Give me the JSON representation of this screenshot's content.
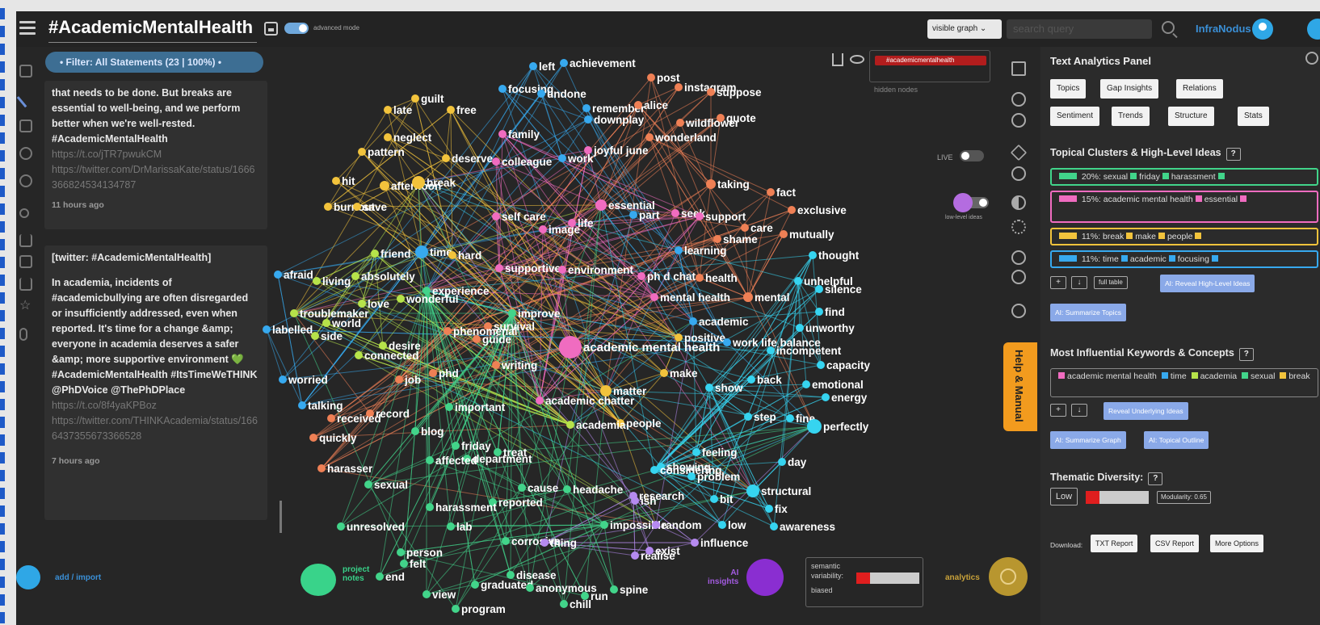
{
  "app": {
    "title": "#AcademicMentalHealth",
    "advanced_mode_label": "advanced mode",
    "brand": "InfraNodus",
    "graph_select": "visible graph",
    "search_placeholder": "search query"
  },
  "filter": {
    "label": "• Filter: All Statements (23 | 100%) •"
  },
  "posts": [
    {
      "body": "that needs to be done. But breaks are essential to well-being, and we perform better when we're well-rested. #AcademicMentalHealth",
      "links": [
        "https://t.co/jTR7pwukCM",
        "https://twitter.com/DrMarissaKate/status/1666366824534134787"
      ],
      "time": "11 hours ago"
    },
    {
      "source": "[twitter: #AcademicMentalHealth]",
      "body": "In academia, incidents of #academicbullying are often disregarded or insufficiently addressed, even when reported. It's time for a change &amp; everyone in academia deserves a safer &amp; more supportive environment 💚 #AcademicMentalHealth #ItsTimeWeTHINK @PhDVoice @ThePhDPlace",
      "links": [
        "https://t.co/8f4yaKPBoz",
        "https://twitter.com/THINKAcademia/status/1666437355673366528"
      ],
      "time": "7 hours ago"
    }
  ],
  "graph": {
    "hidden_tag": "#academicmentalhealth",
    "hidden_label": "hidden nodes",
    "live_label": "LIVE",
    "lowlevel_label": "low-level ideas",
    "colors": {
      "pink": "#f06cc0",
      "orange": "#ef8055",
      "yellow": "#f2c33c",
      "lime": "#b6e34a",
      "green": "#42d48a",
      "blue": "#37a9ef",
      "cyan": "#36d4f0",
      "violet": "#b68af0"
    },
    "nodes": [
      {
        "t": "left",
        "c": "blue"
      },
      {
        "t": "achievement",
        "c": "blue"
      },
      {
        "t": "post",
        "c": "orange"
      },
      {
        "t": "focusing",
        "c": "blue"
      },
      {
        "t": "undone",
        "c": "blue"
      },
      {
        "t": "instagram",
        "c": "orange"
      },
      {
        "t": "suppose",
        "c": "orange"
      },
      {
        "t": "remember",
        "c": "blue"
      },
      {
        "t": "alice",
        "c": "orange"
      },
      {
        "t": "downplay",
        "c": "blue"
      },
      {
        "t": "wildflower",
        "c": "orange"
      },
      {
        "t": "quote",
        "c": "orange"
      },
      {
        "t": "guilt",
        "c": "yellow"
      },
      {
        "t": "late",
        "c": "yellow"
      },
      {
        "t": "free",
        "c": "yellow"
      },
      {
        "t": "family",
        "c": "pink"
      },
      {
        "t": "wonderland",
        "c": "orange"
      },
      {
        "t": "neglect",
        "c": "yellow"
      },
      {
        "t": "joyful june",
        "c": "pink"
      },
      {
        "t": "pattern",
        "c": "yellow"
      },
      {
        "t": "deserve",
        "c": "yellow"
      },
      {
        "t": "colleague",
        "c": "pink"
      },
      {
        "t": "work",
        "c": "blue"
      },
      {
        "t": "hit",
        "c": "yellow"
      },
      {
        "t": "afternoon",
        "c": "yellow"
      },
      {
        "t": "break",
        "c": "yellow"
      },
      {
        "t": "taking",
        "c": "orange"
      },
      {
        "t": "fact",
        "c": "orange"
      },
      {
        "t": "burnout",
        "c": "yellow"
      },
      {
        "t": "save",
        "c": "yellow"
      },
      {
        "t": "essential",
        "c": "pink"
      },
      {
        "t": "exclusive",
        "c": "orange"
      },
      {
        "t": "part",
        "c": "blue"
      },
      {
        "t": "seek",
        "c": "pink"
      },
      {
        "t": "self care",
        "c": "pink"
      },
      {
        "t": "support",
        "c": "pink"
      },
      {
        "t": "life",
        "c": "pink"
      },
      {
        "t": "image",
        "c": "pink"
      },
      {
        "t": "care",
        "c": "orange"
      },
      {
        "t": "mutually",
        "c": "orange"
      },
      {
        "t": "shame",
        "c": "orange"
      },
      {
        "t": "learning",
        "c": "blue"
      },
      {
        "t": "friend",
        "c": "lime"
      },
      {
        "t": "time",
        "c": "blue"
      },
      {
        "t": "hard",
        "c": "yellow"
      },
      {
        "t": "thought",
        "c": "cyan"
      },
      {
        "t": "afraid",
        "c": "blue"
      },
      {
        "t": "supportive",
        "c": "pink"
      },
      {
        "t": "environment",
        "c": "pink"
      },
      {
        "t": "living",
        "c": "lime"
      },
      {
        "t": "absolutely",
        "c": "lime"
      },
      {
        "t": "ph d chat",
        "c": "pink"
      },
      {
        "t": "health",
        "c": "orange"
      },
      {
        "t": "unhelpful",
        "c": "cyan"
      },
      {
        "t": "silence",
        "c": "cyan"
      },
      {
        "t": "experience",
        "c": "green"
      },
      {
        "t": "wonderful",
        "c": "lime"
      },
      {
        "t": "love",
        "c": "lime"
      },
      {
        "t": "mental health",
        "c": "pink"
      },
      {
        "t": "mental",
        "c": "orange"
      },
      {
        "t": "troublemaker",
        "c": "lime"
      },
      {
        "t": "improve",
        "c": "green"
      },
      {
        "t": "find",
        "c": "cyan"
      },
      {
        "t": "world",
        "c": "lime"
      },
      {
        "t": "academic",
        "c": "blue"
      },
      {
        "t": "labelled",
        "c": "blue"
      },
      {
        "t": "side",
        "c": "lime"
      },
      {
        "t": "survival",
        "c": "orange"
      },
      {
        "t": "unworthy",
        "c": "cyan"
      },
      {
        "t": "phenomenal",
        "c": "orange"
      },
      {
        "t": "positive",
        "c": "yellow"
      },
      {
        "t": "guide",
        "c": "orange"
      },
      {
        "t": "academic mental health",
        "c": "pink"
      },
      {
        "t": "work life balance",
        "c": "blue"
      },
      {
        "t": "desire",
        "c": "lime"
      },
      {
        "t": "connected",
        "c": "lime"
      },
      {
        "t": "incompetent",
        "c": "cyan"
      },
      {
        "t": "writing",
        "c": "orange"
      },
      {
        "t": "capacity",
        "c": "cyan"
      },
      {
        "t": "phd",
        "c": "orange"
      },
      {
        "t": "make",
        "c": "yellow"
      },
      {
        "t": "worried",
        "c": "blue"
      },
      {
        "t": "job",
        "c": "orange"
      },
      {
        "t": "back",
        "c": "cyan"
      },
      {
        "t": "show",
        "c": "cyan"
      },
      {
        "t": "emotional",
        "c": "cyan"
      },
      {
        "t": "matter",
        "c": "yellow"
      },
      {
        "t": "academic chatter",
        "c": "pink"
      },
      {
        "t": "energy",
        "c": "cyan"
      },
      {
        "t": "talking",
        "c": "blue"
      },
      {
        "t": "important",
        "c": "green"
      },
      {
        "t": "record",
        "c": "orange"
      },
      {
        "t": "received",
        "c": "orange"
      },
      {
        "t": "step",
        "c": "cyan"
      },
      {
        "t": "fine",
        "c": "cyan"
      },
      {
        "t": "people",
        "c": "yellow"
      },
      {
        "t": "academia",
        "c": "lime"
      },
      {
        "t": "perfectly",
        "c": "cyan"
      },
      {
        "t": "blog",
        "c": "green"
      },
      {
        "t": "quickly",
        "c": "orange"
      },
      {
        "t": "friday",
        "c": "green"
      },
      {
        "t": "treat",
        "c": "green"
      },
      {
        "t": "feeling",
        "c": "cyan"
      },
      {
        "t": "department",
        "c": "green"
      },
      {
        "t": "affected",
        "c": "green"
      },
      {
        "t": "day",
        "c": "cyan"
      },
      {
        "t": "showing",
        "c": "cyan"
      },
      {
        "t": "harasser",
        "c": "orange"
      },
      {
        "t": "considering",
        "c": "cyan"
      },
      {
        "t": "problem",
        "c": "cyan"
      },
      {
        "t": "sexual",
        "c": "green"
      },
      {
        "t": "cause",
        "c": "green"
      },
      {
        "t": "headache",
        "c": "green"
      },
      {
        "t": "structural",
        "c": "cyan"
      },
      {
        "t": "research",
        "c": "violet"
      },
      {
        "t": "bit",
        "c": "cyan"
      },
      {
        "t": "ish",
        "c": "violet"
      },
      {
        "t": "reported",
        "c": "green"
      },
      {
        "t": "harassment",
        "c": "green"
      },
      {
        "t": "fix",
        "c": "cyan"
      },
      {
        "t": "impossible",
        "c": "green"
      },
      {
        "t": "random",
        "c": "violet"
      },
      {
        "t": "low",
        "c": "cyan"
      },
      {
        "t": "awareness",
        "c": "cyan"
      },
      {
        "t": "unresolved",
        "c": "green"
      },
      {
        "t": "lab",
        "c": "green"
      },
      {
        "t": "corrosive",
        "c": "green"
      },
      {
        "t": "thing",
        "c": "violet"
      },
      {
        "t": "influence",
        "c": "violet"
      },
      {
        "t": "person",
        "c": "green"
      },
      {
        "t": "realise",
        "c": "violet"
      },
      {
        "t": "exist",
        "c": "violet"
      },
      {
        "t": "felt",
        "c": "green"
      },
      {
        "t": "end",
        "c": "green"
      },
      {
        "t": "disease",
        "c": "green"
      },
      {
        "t": "graduated",
        "c": "green"
      },
      {
        "t": "anonymous",
        "c": "green"
      },
      {
        "t": "spine",
        "c": "green"
      },
      {
        "t": "view",
        "c": "green"
      },
      {
        "t": "run",
        "c": "green"
      },
      {
        "t": "chill",
        "c": "green"
      },
      {
        "t": "program",
        "c": "green"
      }
    ]
  },
  "panel": {
    "title": "Text Analytics Panel",
    "tabs_row1": [
      "Topics",
      "Gap Insights",
      "Relations"
    ],
    "tabs_row2": [
      "Sentiment",
      "Trends",
      "Structure",
      "Stats"
    ],
    "clusters_title": "Topical Clusters & High-Level Ideas",
    "help_q": "?",
    "clusters": [
      {
        "color": "#41d48a",
        "pct": "20%:",
        "words": [
          "sexual",
          "friday",
          "harassment"
        ]
      },
      {
        "color": "#f06cc0",
        "pct": "15%:",
        "words": [
          "academic mental health",
          "essential"
        ]
      },
      {
        "color": "#f2c33c",
        "pct": "11%:",
        "words": [
          "break",
          "make",
          "people"
        ]
      },
      {
        "color": "#37a9ef",
        "pct": "11%:",
        "words": [
          "time",
          "academic",
          "focusing"
        ]
      }
    ],
    "plus": "+",
    "down": "↓",
    "full_table": "full table",
    "reveal_high": "AI: Reveal High-Level Ideas",
    "summarize_topics": "AI: Summarize Topics",
    "kw_title": "Most Influential Keywords & Concepts",
    "keywords": [
      "academic mental health",
      "time",
      "academia",
      "sexual",
      "break"
    ],
    "reveal_under": "Reveal Underlying Ideas",
    "summarize_graph": "AI: Summarize Graph",
    "topical_outline": "AI: Topical Outline",
    "diversity_title": "Thematic Diversity:",
    "diversity_value": "Low",
    "diversity_level": 0.22,
    "modularity": "Modularity: 0.65",
    "download_label": "Download:",
    "download_buttons": [
      "TXT Report",
      "CSV Report",
      "More Options"
    ]
  },
  "help_manual": "Help & Manual",
  "bottom": {
    "add_import": "add / import",
    "project_notes_1": "project",
    "project_notes_2": "notes",
    "ai_1": "AI",
    "ai_2": "insights",
    "semvar_1": "semantic",
    "semvar_2": "variability:",
    "semvar_3": "biased",
    "semvar_level": 0.22,
    "analytics": "analytics"
  }
}
